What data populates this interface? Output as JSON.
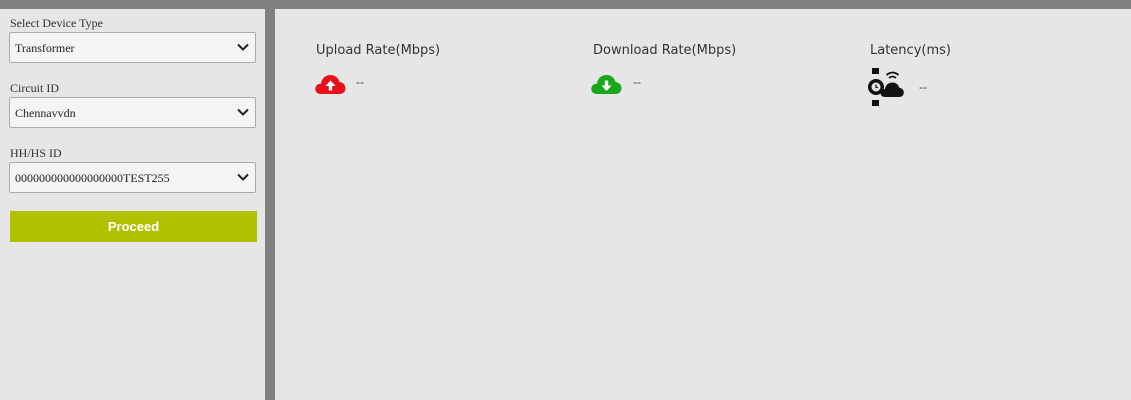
{
  "sidebar": {
    "device_type": {
      "label": "Select Device Type",
      "value": "Transformer"
    },
    "circuit_id": {
      "label": "Circuit ID",
      "value": "Chennavvdn"
    },
    "hh_hs_id": {
      "label": "HH/HS ID",
      "value": "000000000000000000TEST255"
    },
    "proceed_label": "Proceed",
    "accent_color": "#b1c000"
  },
  "metrics": {
    "upload": {
      "label": "Upload Rate(Mbps)",
      "value": "--",
      "icon": "cloud-upload-icon",
      "color": "#e8101a"
    },
    "download": {
      "label": "Download Rate(Mbps)",
      "value": "--",
      "icon": "cloud-download-icon",
      "color": "#1aa81a"
    },
    "latency": {
      "label": "Latency(ms)",
      "value": "--",
      "icon": "watch-cloud-icon",
      "color": "#111111"
    }
  }
}
